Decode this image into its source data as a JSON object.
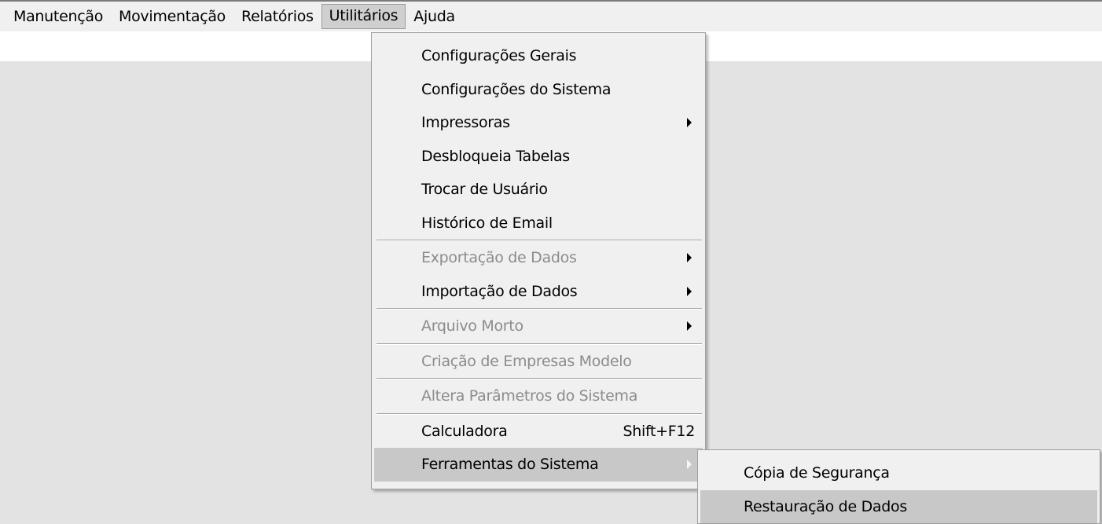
{
  "menubar": {
    "items": [
      "Manutenção",
      "Movimentação",
      "Relatórios",
      "Utilitários",
      "Ajuda"
    ],
    "active": "Utilitários"
  },
  "utilitarios_menu": {
    "configuracoes_gerais": "Configurações Gerais",
    "configuracoes_sistema": "Configurações do Sistema",
    "impressoras": "Impressoras",
    "desbloqueia_tabelas": "Desbloqueia Tabelas",
    "trocar_usuario": "Trocar de Usuário",
    "historico_email": "Histórico de Email",
    "exportacao_dados": "Exportação de Dados",
    "importacao_dados": "Importação de Dados",
    "arquivo_morto": "Arquivo Morto",
    "criacao_empresas": "Criação de Empresas Modelo",
    "altera_parametros": "Altera Parâmetros do Sistema",
    "calculadora": "Calculadora",
    "calculadora_shortcut": "Shift+F12",
    "ferramentas_sistema": "Ferramentas do Sistema"
  },
  "ferramentas_submenu": {
    "copia_seguranca": "Cópia de Segurança",
    "restauracao_dados": "Restauração de Dados"
  },
  "colors": {
    "menu_bg": "#f0f0f0",
    "highlight": "#c8c8c8",
    "disabled_text": "#8c8c8c",
    "client_bg": "#e3e3e3"
  }
}
